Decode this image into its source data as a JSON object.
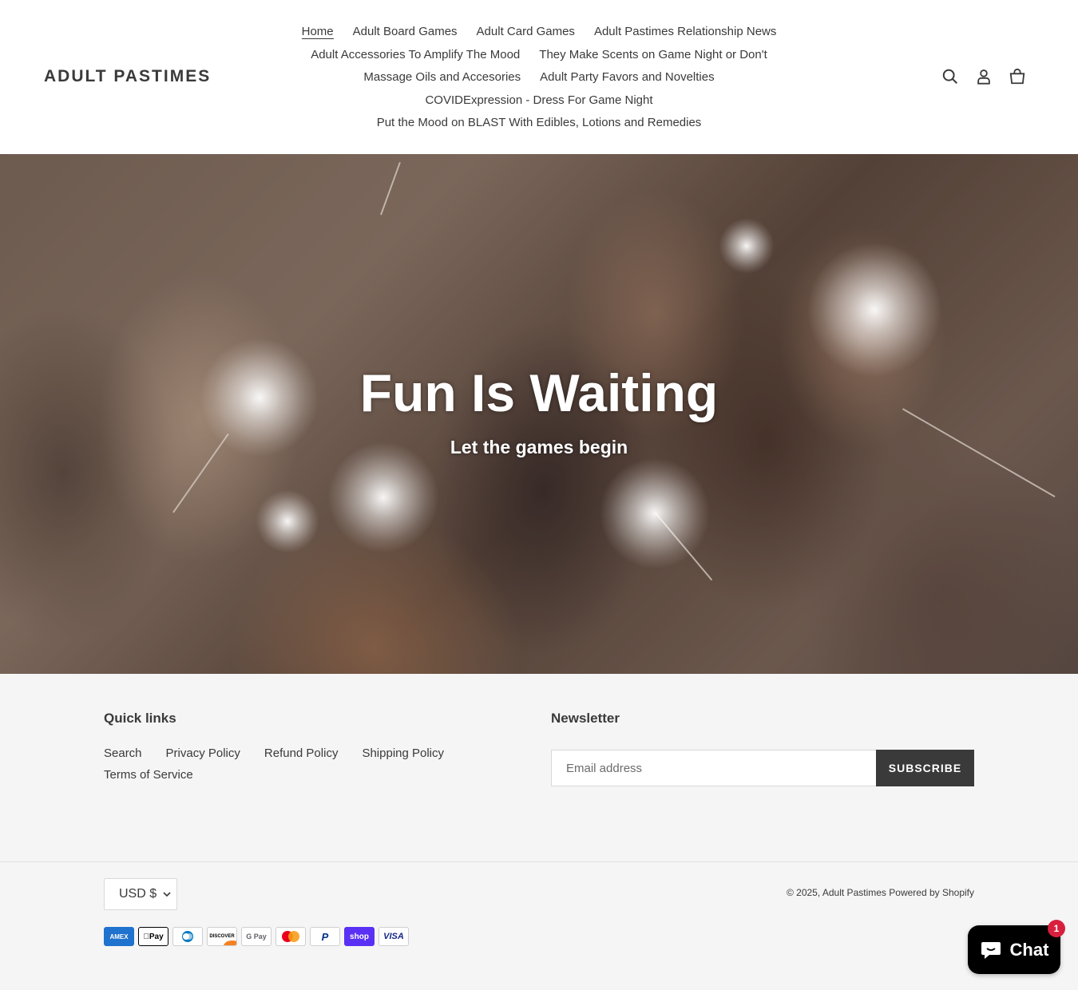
{
  "header": {
    "logo": "ADULT PASTIMES",
    "nav": [
      {
        "label": "Home",
        "active": true
      },
      {
        "label": "Adult Board Games"
      },
      {
        "label": "Adult Card Games"
      },
      {
        "label": "Adult Pastimes Relationship News"
      },
      {
        "label": "Adult Accessories To Amplify The Mood"
      },
      {
        "label": "They Make Scents on Game Night or Don't"
      },
      {
        "label": "Massage Oils and Accesories"
      },
      {
        "label": "Adult Party Favors and Novelties"
      },
      {
        "label": "COVIDExpression - Dress For Game Night"
      },
      {
        "label": "Put the Mood on BLAST With Edibles, Lotions and Remedies"
      }
    ],
    "icons": [
      "search-icon",
      "account-icon",
      "cart-icon"
    ]
  },
  "hero": {
    "title": "Fun Is Waiting",
    "subtitle": "Let the games begin"
  },
  "footer": {
    "quick_links_title": "Quick links",
    "quick_links": [
      "Search",
      "Privacy Policy",
      "Refund Policy",
      "Shipping Policy",
      "Terms of Service"
    ],
    "newsletter_title": "Newsletter",
    "email_placeholder": "Email address",
    "subscribe_label": "SUBSCRIBE",
    "currency": "USD $",
    "copyright_prefix": "© 2025,",
    "copyright_store": "Adult Pastimes",
    "powered_by": "Powered by Shopify",
    "payment_methods": [
      {
        "name": "American Express",
        "label": "AMEX",
        "bg": "#1f72cd",
        "fg": "#ffffff"
      },
      {
        "name": "Apple Pay",
        "label": "Pay",
        "bg": "#ffffff",
        "fg": "#000000"
      },
      {
        "name": "Diners Club",
        "label": "D",
        "bg": "#ffffff",
        "fg": "#0079be"
      },
      {
        "name": "Discover",
        "label": "DISCOVER",
        "bg": "#ffffff",
        "fg": "#000000"
      },
      {
        "name": "Google Pay",
        "label": "G Pay",
        "bg": "#ffffff",
        "fg": "#5f6368"
      },
      {
        "name": "Mastercard",
        "label": "",
        "bg": "#ffffff",
        "fg": "#000000"
      },
      {
        "name": "PayPal",
        "label": "P",
        "bg": "#ffffff",
        "fg": "#003087"
      },
      {
        "name": "Shop Pay",
        "label": "shop",
        "bg": "#5a31f4",
        "fg": "#ffffff"
      },
      {
        "name": "Visa",
        "label": "VISA",
        "bg": "#ffffff",
        "fg": "#142688"
      }
    ]
  },
  "chat": {
    "label": "Chat",
    "badge": "1"
  }
}
